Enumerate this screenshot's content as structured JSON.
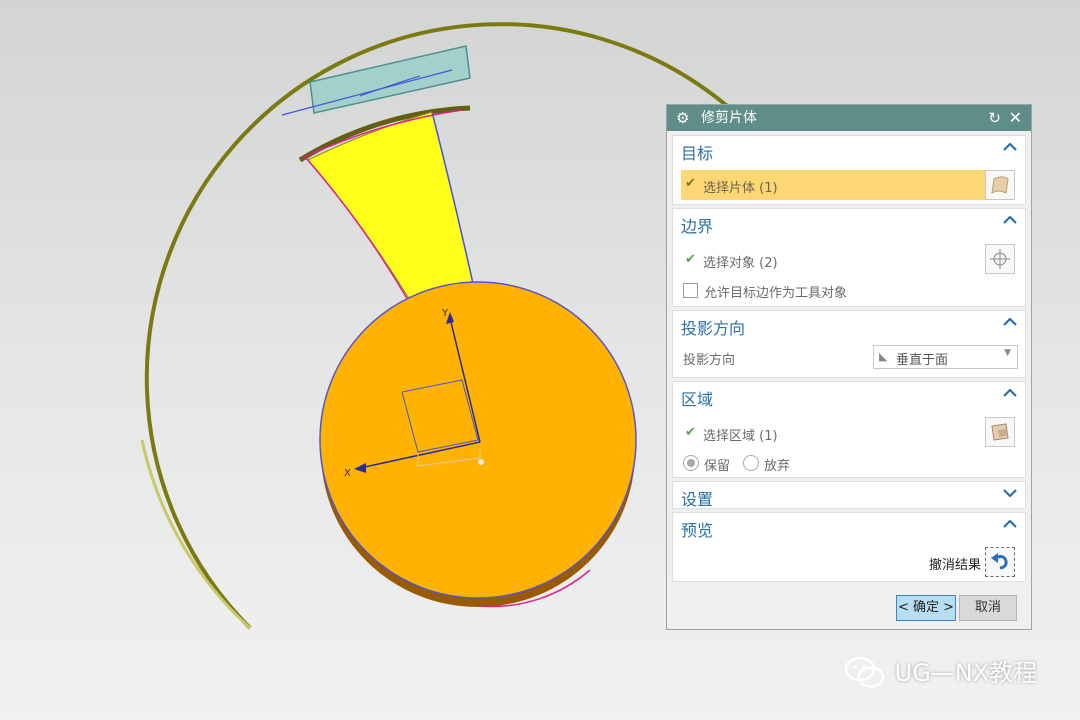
{
  "dialog": {
    "title": "修剪片体",
    "sections": {
      "target": {
        "title": "目标",
        "select_label": "选择片体 (1)"
      },
      "boundary": {
        "title": "边界",
        "select_label": "选择对象 (2)",
        "allow_label": "允许目标边作为工具对象"
      },
      "projection": {
        "title": "投影方向",
        "row_label": "投影方向",
        "dropdown_value": "垂直于面"
      },
      "region": {
        "title": "区域",
        "select_label": "选择区域 (1)",
        "keep_label": "保留",
        "discard_label": "放弃"
      },
      "settings": {
        "title": "设置"
      },
      "preview": {
        "title": "预览",
        "undo_label": "撤消结果"
      }
    },
    "ok_label": "< 确定 >",
    "cancel_label": "取消"
  },
  "viewport": {
    "axis_x_label": "X",
    "axis_y_label": "Y"
  },
  "watermark": {
    "text": "UG—NX教程"
  },
  "colors": {
    "titlebar": "#5f8d88",
    "section_title": "#2a6fa8",
    "highlight": "#fcd774",
    "disk": "#ffb300",
    "sheet": "#ffff1a",
    "ring": "#7a7a10"
  },
  "icons": [
    "gear-icon",
    "reset-icon",
    "close-icon",
    "chevron-up-icon",
    "chevron-down-icon",
    "check-icon",
    "sheet-body-icon",
    "crosshair-icon",
    "region-icon",
    "projection-icon",
    "undo-icon",
    "wechat-icon"
  ]
}
